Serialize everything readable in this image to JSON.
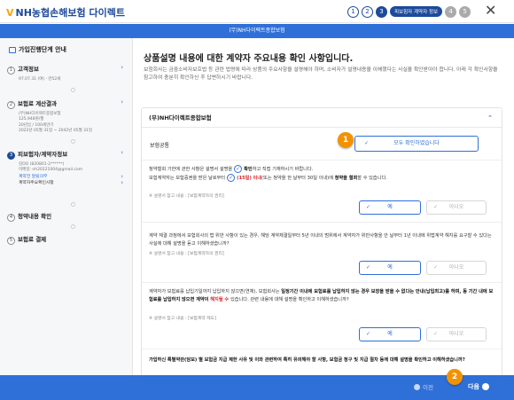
{
  "app": {
    "logo_mark": "V",
    "logo_text": "NH농협손해보험 다이렉트",
    "steps": [
      "1",
      "2",
      "3",
      "4",
      "5"
    ],
    "current_step_label": "피보험자 계약자 정보",
    "header_title": "(무)NH다이렉트종합보험"
  },
  "sidebar": {
    "title": "가입진행단계 안내",
    "items": [
      {
        "num": "1",
        "label": "고객정보",
        "sub": [
          "97.07.31 (여) · 만52세"
        ]
      },
      {
        "num": "2",
        "label": "보험료 계산결과",
        "sub": [
          "(무)NH다이렉트종합보험",
          "125,948원/월",
          "20년납 / 100세만기",
          "2022년 05월 31일 ~ 2042년 05월 31일"
        ]
      },
      {
        "num": "3",
        "label": "피보험자/계약자정보",
        "sub": [
          "김OO (820801-2******)",
          "이메일: nh20221004@gmail.com"
        ],
        "links": [
          "계약전 알릴의무",
          "계약자주요확인사항"
        ]
      },
      {
        "num": "4",
        "label": "청약내용 확인"
      },
      {
        "num": "5",
        "label": "보험료 결제"
      }
    ]
  },
  "main": {
    "title": "상품설명 내용에 대한 계약자 주요내용 확인 사항입니다.",
    "intro": "보험회사는 금융소비자보호법 등 관련 법령에 따라 상품의 주요사항을 설명해야 하며, 소비자가 설명내용을 이해했다는 사실을 확인받아야 합니다. 아래 각 확인사항을 참고하여 충분히 확인하신 후 답변하시기 바랍니다.",
    "section_title": "(무)NH다이렉트종합보험",
    "common_label": "보험공통",
    "check_all_label": "모두 확인하였습니다",
    "q1_line1_a": "청약철회 기한에 관한 사항은 설명서 설명을",
    "q1_line1_b": "확인",
    "q1_line1_c": "하고 직접 기재하시기 바랍니다.",
    "q1_line2_a": "보험계약자는 보험증권을 받은 날로부터",
    "q1_days": "(15일)",
    "q1_line2_b": "이내",
    "q1_line2_c": "(또는 청약을 한 날부터 30일 이내)에",
    "q1_line2_d": "청약을 철회",
    "q1_line2_e": "할 수 있습니다.",
    "q1_note": "※ 설명서 참고 내용 : [보험계약자의 권리]",
    "q2_text_a": "계약 체결 과정에서 보험회사의 법 위반 사항이 있는 경우, 해당 계약체결일부터 5년 이내의 범위에서 계약자가 위반사항을 안 날부터 1년 이내에 위법계약 해지를 요구할 수 있다는 사실에 대해 설명을 듣고 이해하셨습니까?",
    "q2_note": "※ 설명서 참고 내용 : [보험계약자의 권리]",
    "q3_text_a": "계약자가 보험료를 납입기일까지 납입하지 않으면(연체), 보험회사는 ",
    "q3_text_b": "일정기간 이내에 보험료를 납입하지 않는 경우 보장을 받을 수 없다는 안내(납입최고)를 하며, 동 기간 내에 보험료를 납입하지 않으면 계약이",
    "q3_text_c": " 해지될 수 ",
    "q3_text_d": "있습니다. 관련 내용에 대해 설명을 확인하고 이해하셨습니까?",
    "q3_note": "※ 설명서 참고 내용 : [보험계약 제도]",
    "q4_text": "가입하신 특별약관(담보) 별 보험금 지급 제한 사유 및 이와 관련하여 특히 유의해야 할 사항, 보험금 청구 및 지급 절차 등에 대해 설명을 확인하고 이해하셨습니까?",
    "yes_label": "예",
    "no_label": "아니오"
  },
  "footer": {
    "prev_label": "이전",
    "next_label": "다음"
  },
  "badges": [
    "1",
    "2"
  ],
  "colors": {
    "brand": "#1d4a9a",
    "accent": "#2f6fd8",
    "badge": "#f39200",
    "warn": "#d8252b"
  }
}
